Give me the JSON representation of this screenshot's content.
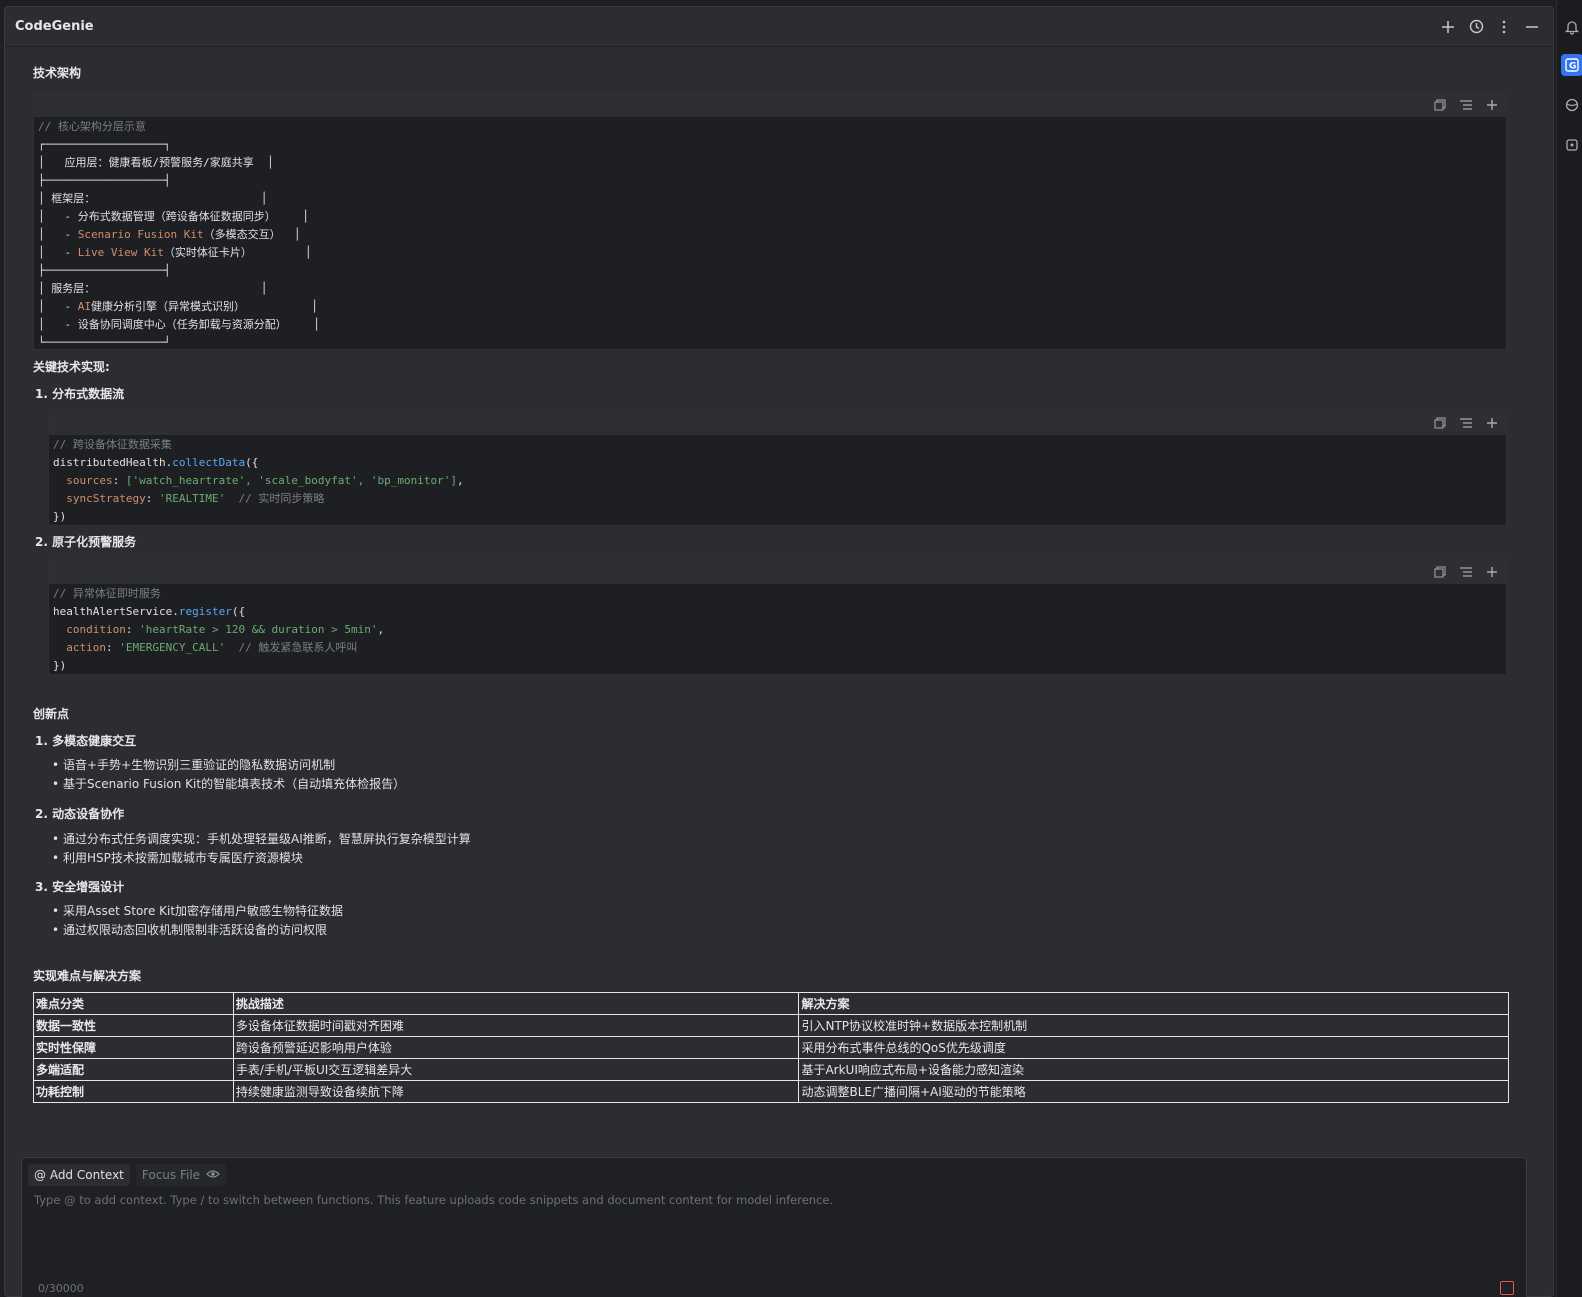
{
  "app": {
    "title": "CodeGenie"
  },
  "toolbar": {
    "icons": [
      "plus-icon",
      "history-icon",
      "more-vertical-icon",
      "minimize-icon"
    ]
  },
  "rightbar": {
    "icons": [
      "bell-icon",
      "codegenie-icon",
      "globe-icon",
      "plugin-icon"
    ]
  },
  "sections": {
    "arch_title": "技术架构",
    "key_tech_title": "关键技术实现:",
    "innovation_title": "创新点",
    "difficulty_title": "实现难点与解决方案"
  },
  "arch_code": {
    "comment": "// 核心架构分层示意",
    "lines": [
      "┌──────────────────┐",
      "│   应用层：健康看板/预警服务/家庭共享  │",
      "├──────────────────┤",
      "│ 框架层：                         │",
      "│   - 分布式数据管理（跨设备体征数据同步）    │",
      "│   - ",
      "│   - ",
      "├──────────────────┤",
      "│ 服务层：                         │",
      "│   - ",
      "│   - 设备协同调度中心（任务卸载与资源分配）    │",
      "└──────────────────┘"
    ],
    "kw_scenario": "Scenario Fusion Kit",
    "rest_scenario": "（多模态交互）  │",
    "kw_liveview": "Live View Kit",
    "rest_liveview": "（实时体征卡片）        │",
    "kw_ai": "AI",
    "rest_ai": "健康分析引擎（异常模式识别）          │"
  },
  "tech1": {
    "title": "1. 分布式数据流",
    "comment": "// 跨设备体征数据采集",
    "obj": "distributedHealth",
    "method": "collectData",
    "open": "({",
    "k1": "sources",
    "v1": "['watch_heartrate', 'scale_bodyfat', 'bp_monitor']",
    "k2": "syncStrategy",
    "v2": "'REALTIME'",
    "c2": "// 实时同步策略",
    "close": "})"
  },
  "tech2": {
    "title": "2. 原子化预警服务",
    "comment": "// 异常体征即时服务",
    "obj": "healthAlertService",
    "method": "register",
    "open": "({",
    "k1": "condition",
    "v1": "'heartRate > 120 && duration > 5min'",
    "k2": "action",
    "v2": "'EMERGENCY_CALL'",
    "c2": "// 触发紧急联系人呼叫",
    "close": "})"
  },
  "innovations": [
    {
      "title": "1. 多模态健康交互",
      "items": [
        "语音+手势+生物识别三重验证的隐私数据访问机制",
        "基于Scenario Fusion Kit的智能填表技术（自动填充体检报告）"
      ]
    },
    {
      "title": "2. 动态设备协作",
      "items": [
        "通过分布式任务调度实现：手机处理轻量级AI推断，智慧屏执行复杂模型计算",
        "利用HSP技术按需加载城市专属医疗资源模块"
      ]
    },
    {
      "title": "3. 安全增强设计",
      "items": [
        "采用Asset Store Kit加密存储用户敏感生物特征数据",
        "通过权限动态回收机制限制非活跃设备的访问权限"
      ]
    }
  ],
  "table": {
    "headers": [
      "难点分类",
      "挑战描述",
      "解决方案"
    ],
    "rows": [
      [
        "数据一致性",
        "多设备体征数据时间戳对齐困难",
        "引入NTP协议校准时钟+数据版本控制机制"
      ],
      [
        "实时性保障",
        "跨设备预警延迟影响用户体验",
        "采用分布式事件总线的QoS优先级调度"
      ],
      [
        "多端适配",
        "手表/手机/平板UI交互逻辑差异大",
        "基于ArkUI响应式布局+设备能力感知渲染"
      ],
      [
        "功耗控制",
        "持续健康监测导致设备续航下降",
        "动态调整BLE广播间隔+AI驱动的节能策略"
      ]
    ]
  },
  "input": {
    "add_context": "@ Add Context",
    "focus_file": "Focus File",
    "placeholder": "Type @ to add context. Type / to switch between functions. This feature uploads code snippets and document content for model inference.",
    "counter": "0/30000"
  },
  "colors": {
    "accent": "#3574f0",
    "send_stop": "#e05555"
  }
}
